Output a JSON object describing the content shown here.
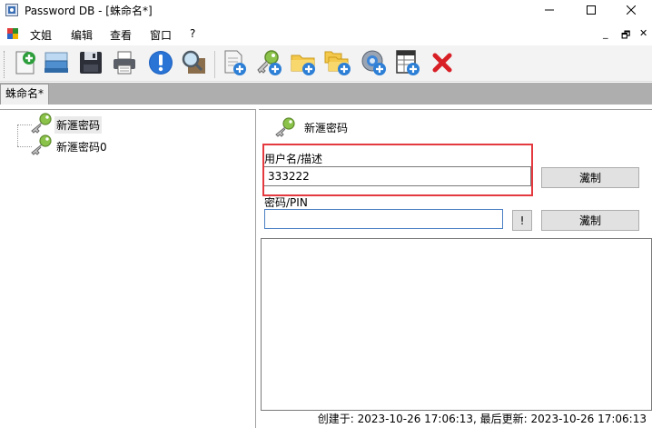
{
  "window": {
    "title": "Password DB - [蛛命名*]",
    "controls": {
      "minimize": "—",
      "maximize": "☐",
      "close": "✕"
    }
  },
  "menubar": {
    "items": [
      "文姐",
      "编辑",
      "查看",
      "窗口",
      "?"
    ],
    "mdi_controls": [
      "_",
      "🗗",
      "✕"
    ]
  },
  "toolbar": {
    "buttons": [
      "new-database-icon",
      "open-database-icon",
      "save-icon",
      "print-icon",
      "info-icon",
      "search-icon",
      "new-document-icon",
      "add-key-icon",
      "add-folder-icon",
      "add-folders-icon",
      "add-web-icon",
      "add-table-icon",
      "delete-icon"
    ]
  },
  "tabs": [
    {
      "label": "蛛命名*"
    }
  ],
  "tree": {
    "items": [
      {
        "label": "新滙密码",
        "selected": true
      },
      {
        "label": "新滙密码0",
        "selected": false
      }
    ]
  },
  "entry": {
    "title": "新滙密码",
    "username_label": "用户名/描述",
    "username_value": "333222",
    "copy_label": "瀻制",
    "password_label": "密码/PIN",
    "password_value": "",
    "reveal_label": "!",
    "copy2_label": "瀻制",
    "notes": ""
  },
  "status": {
    "text": "创建于: 2023-10-26 17:06:13, 最后更新: 2023-10-26 17:06:13"
  },
  "colors": {
    "highlight": "#e43a3f",
    "tab_strip": "#aeaeae",
    "key_green": "#8bc34a",
    "plus_blue": "#2d7fd6",
    "delete_red": "#d81f26"
  }
}
